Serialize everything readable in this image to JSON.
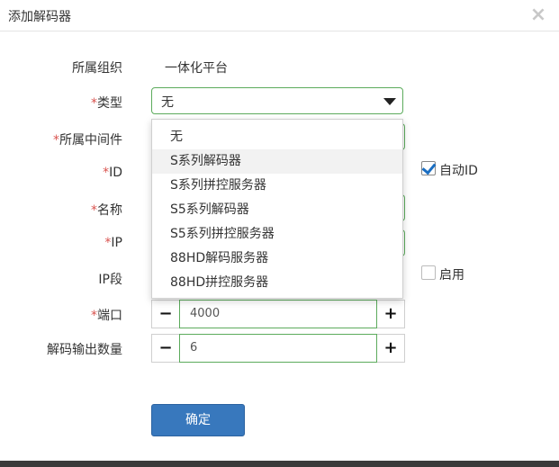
{
  "dialog": {
    "title": "添加解码器",
    "close_icon": "×"
  },
  "form": {
    "org_label": "所属组织",
    "org_value": "一体化平台",
    "required_mark": "*",
    "type_label": "类型",
    "type_value": "无",
    "middleware_label": "所属中间件",
    "id_label": "ID",
    "auto_id_label": "自动ID",
    "auto_id_checked": true,
    "name_label": "名称",
    "ip_label": "IP",
    "ip_range_label": "IP段",
    "enable_label": "启用",
    "enable_checked": false,
    "port_label": "端口",
    "port_value": "4000",
    "decode_output_label": "解码输出数量",
    "decode_output_value": "6",
    "minus_icon": "−",
    "plus_icon": "+"
  },
  "dropdown": {
    "options": [
      "无",
      "S系列解码器",
      "S系列拼控服务器",
      "S5系列解码器",
      "S5系列拼控服务器",
      "88HD解码服务器",
      "88HD拼控服务器"
    ],
    "highlighted_index": 1
  },
  "footer": {
    "ok_label": "确定"
  },
  "colors": {
    "accent_border": "#5cab5c",
    "primary_button": "#3878bd",
    "required": "#d9534f"
  }
}
